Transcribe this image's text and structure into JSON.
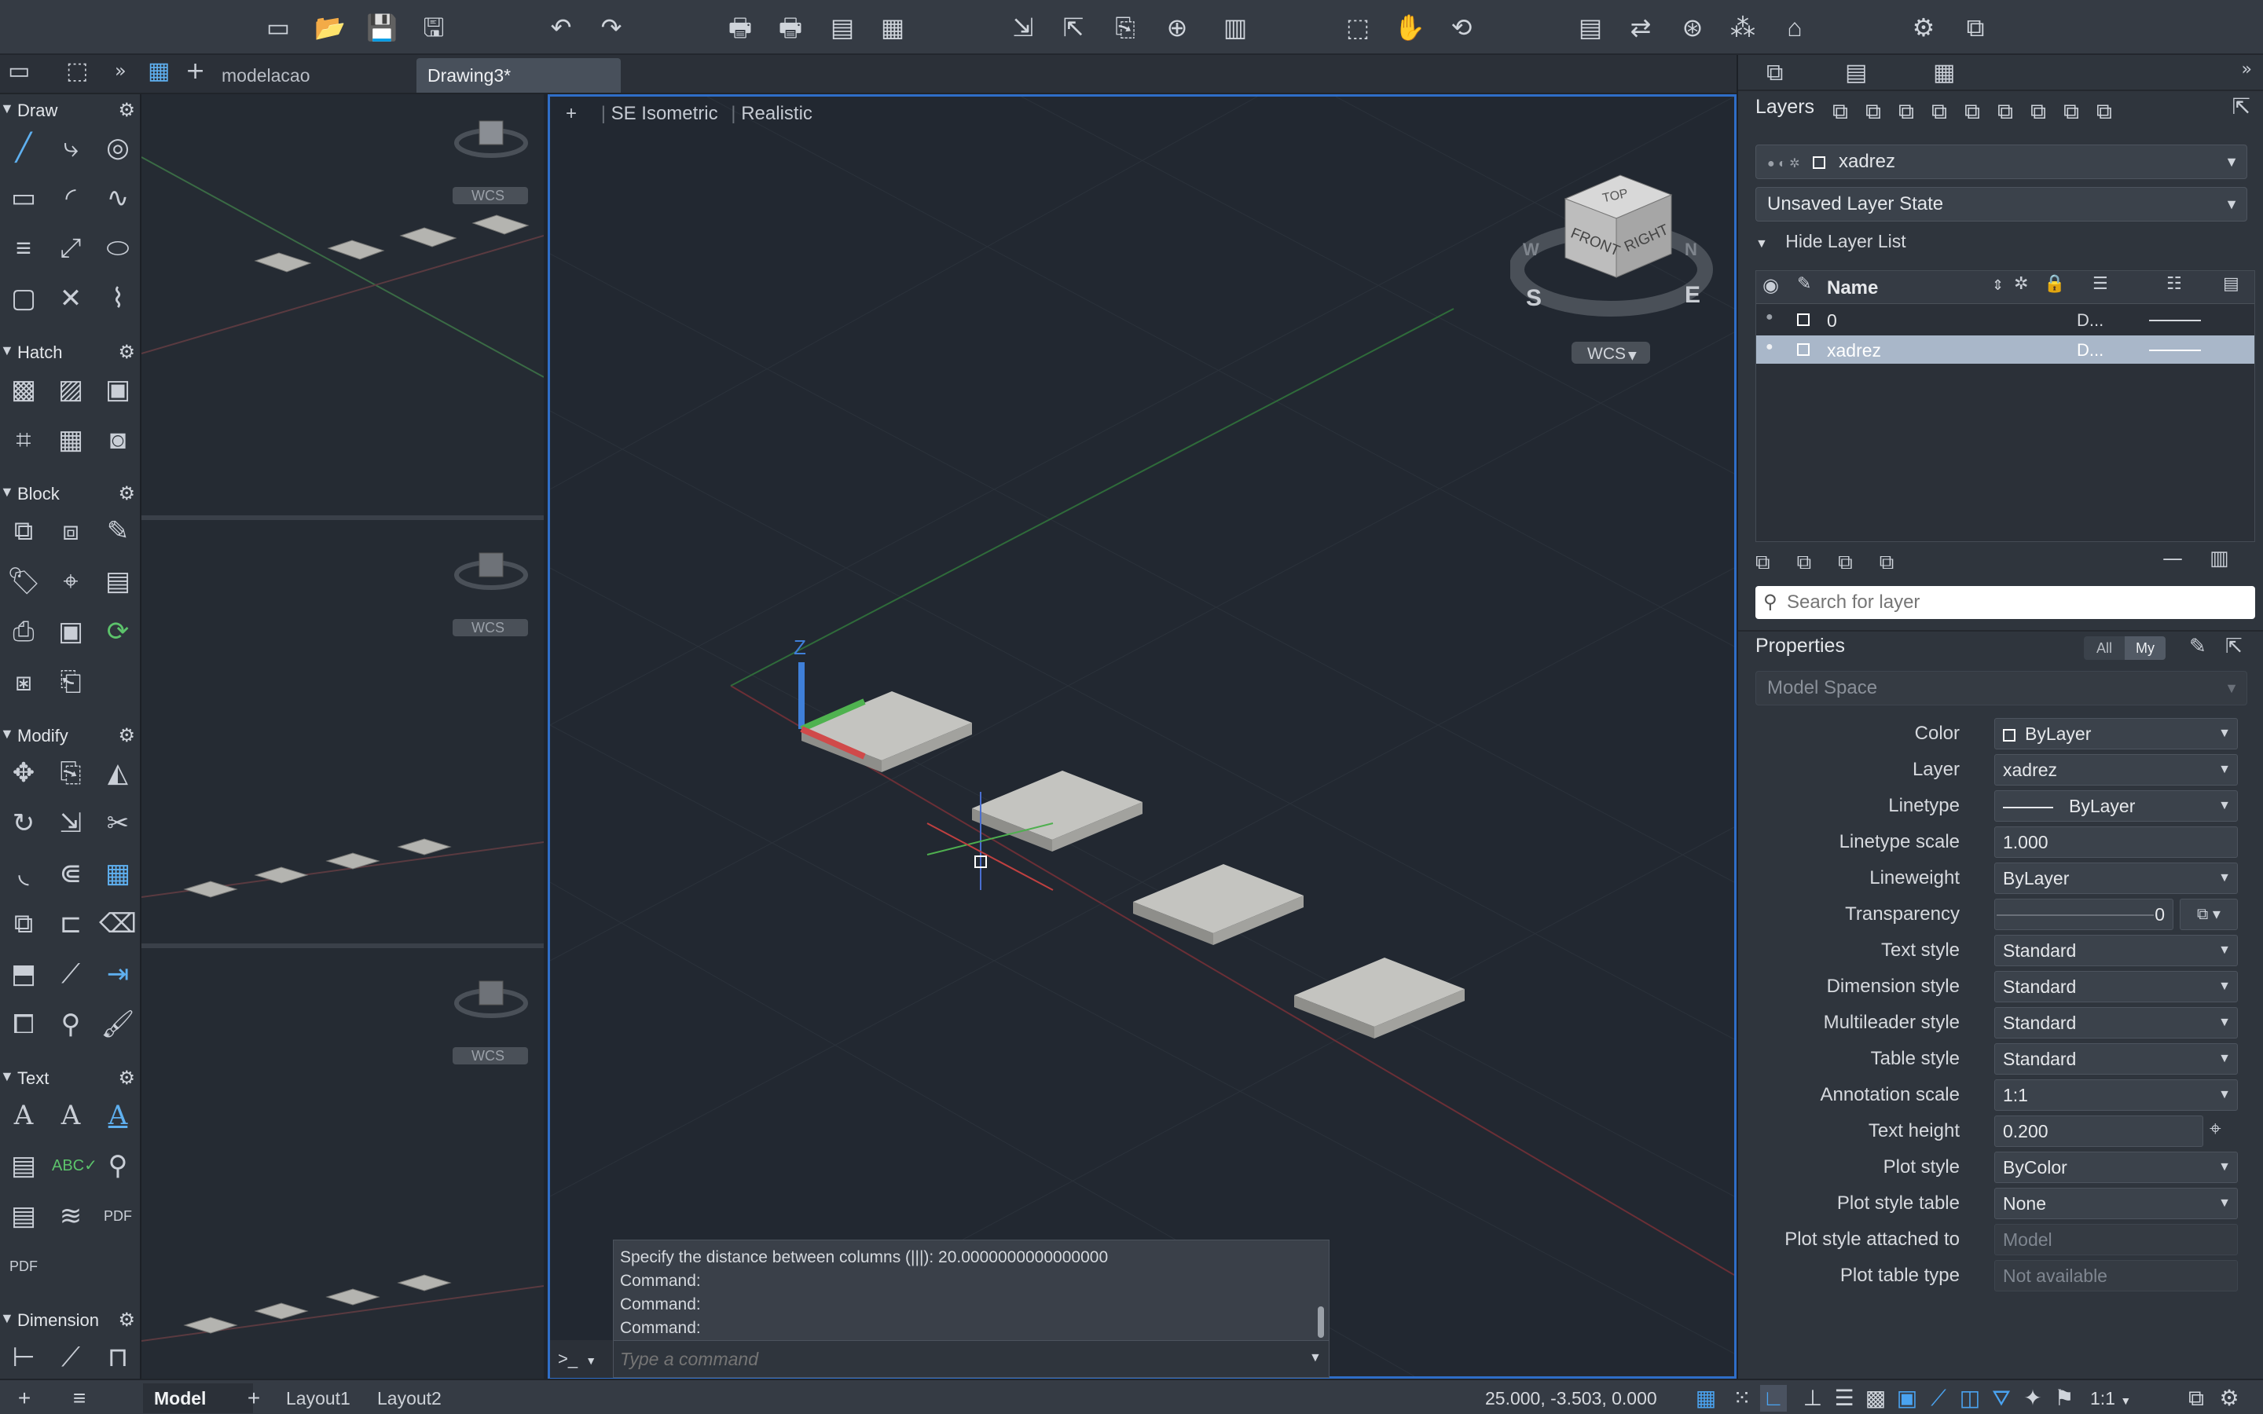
{
  "toolbar": {
    "icons": [
      "new-file-icon",
      "open-file-icon",
      "save-icon",
      "save-as-icon",
      "undo-icon",
      "redo-icon",
      "plot-icon",
      "batch-plot-icon",
      "page-setup-icon",
      "publish-icon",
      "import-icon",
      "export-icon",
      "attach-icon",
      "web-icon",
      "alerts-icon",
      "zoom-window-icon",
      "pan-icon",
      "orbit-icon",
      "properties-icon",
      "match-properties-icon",
      "xref-icon",
      "network-icon",
      "purge-icon",
      "settings-icon",
      "compare-icon"
    ]
  },
  "tabs": {
    "items": [
      {
        "label": "modelacao"
      },
      {
        "label": "Drawing3*"
      }
    ]
  },
  "palette": {
    "sections": [
      {
        "title": "Draw"
      },
      {
        "title": "Hatch"
      },
      {
        "title": "Block"
      },
      {
        "title": "Modify"
      },
      {
        "title": "Text"
      },
      {
        "title": "Dimension"
      }
    ]
  },
  "viewports": {
    "left_wcs": [
      "WCS",
      "WCS",
      "WCS"
    ],
    "main": {
      "plus": "+",
      "view": "SE Isometric",
      "style": "Realistic",
      "wcs": "WCS",
      "cube": {
        "top": "TOP",
        "front": "FRONT",
        "right": "RIGHT",
        "compass_s": "S",
        "compass_e": "E",
        "compass_w": "W",
        "compass_n": "N"
      },
      "z_axis": "Z"
    }
  },
  "command": {
    "history": [
      "Specify the distance between columns (|||): 20.0000000000000000",
      "Command:",
      "Command:",
      "Command:"
    ],
    "prompt_icon": ">_",
    "placeholder": "Type a command"
  },
  "layers": {
    "title": "Layers",
    "current_layer": "xadrez",
    "layer_state": "Unsaved Layer State",
    "hide_list": "Hide Layer List",
    "column_name": "Name",
    "rows": [
      {
        "name": "0",
        "linetype": "D..."
      },
      {
        "name": "xadrez",
        "linetype": "D..."
      }
    ],
    "search_placeholder": "Search for layer"
  },
  "properties": {
    "title": "Properties",
    "filter_all": "All",
    "filter_my": "My",
    "space": "Model Space",
    "rows": [
      {
        "label": "Color",
        "value": "ByLayer"
      },
      {
        "label": "Layer",
        "value": "xadrez"
      },
      {
        "label": "Linetype",
        "value": "ByLayer"
      },
      {
        "label": "Linetype scale",
        "value": "1.000"
      },
      {
        "label": "Lineweight",
        "value": "ByLayer"
      },
      {
        "label": "Transparency",
        "value": "0"
      },
      {
        "label": "Text style",
        "value": "Standard"
      },
      {
        "label": "Dimension style",
        "value": "Standard"
      },
      {
        "label": "Multileader style",
        "value": "Standard"
      },
      {
        "label": "Table style",
        "value": "Standard"
      },
      {
        "label": "Annotation scale",
        "value": "1:1"
      },
      {
        "label": "Text height",
        "value": "0.200"
      },
      {
        "label": "Plot style",
        "value": "ByColor"
      },
      {
        "label": "Plot style table",
        "value": "None"
      },
      {
        "label": "Plot style attached to",
        "value": "Model"
      },
      {
        "label": "Plot table type",
        "value": "Not available"
      }
    ]
  },
  "status": {
    "tabs": [
      {
        "label": "Model"
      },
      {
        "label": "Layout1"
      },
      {
        "label": "Layout2"
      }
    ],
    "coords": "25.000, -3.503, 0.000",
    "scale": "1:1"
  },
  "colors": {
    "accent": "#2f6ec8",
    "selection": "#a9b7c9",
    "tile": "#b8b8b4"
  }
}
